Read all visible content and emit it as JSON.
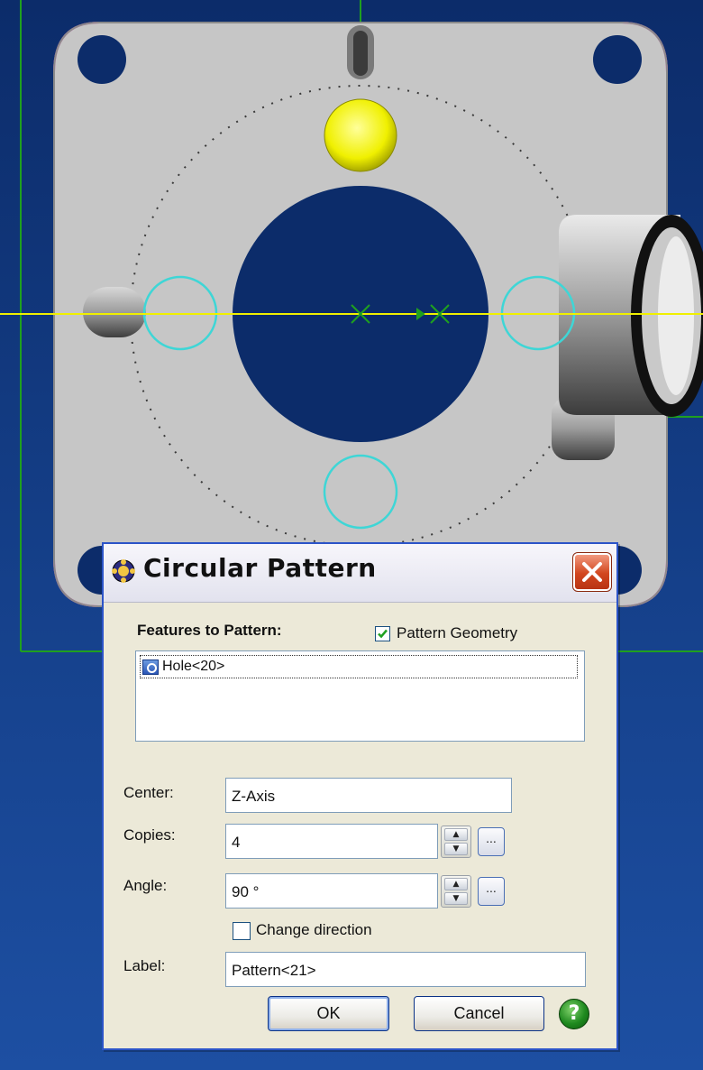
{
  "dialog": {
    "title": "Circular Pattern",
    "features_label": "Features to Pattern:",
    "pattern_geometry": {
      "label": "Pattern Geometry",
      "checked": true
    },
    "features_list": [
      {
        "label": "Hole<20>"
      }
    ],
    "center": {
      "label": "Center:",
      "value": "Z-Axis"
    },
    "copies": {
      "label": "Copies:",
      "value": "4",
      "button": "..."
    },
    "angle": {
      "label": "Angle:",
      "value": "90 °",
      "button": "..."
    },
    "change_direction": {
      "label": "Change direction",
      "checked": false
    },
    "label_field": {
      "label": "Label:",
      "value": "Pattern<21>"
    },
    "ok_label": "OK",
    "cancel_label": "Cancel",
    "help_glyph": "?",
    "close_glyph": "✕"
  },
  "colors": {
    "viewport_bg": "#14326f",
    "part_gray": "#c4c4c4",
    "selected_hole": "#f0f000",
    "pattern_preview": "#3ed6d6",
    "axis_green": "#1fa01f",
    "axis_yellow": "#f0f000"
  }
}
